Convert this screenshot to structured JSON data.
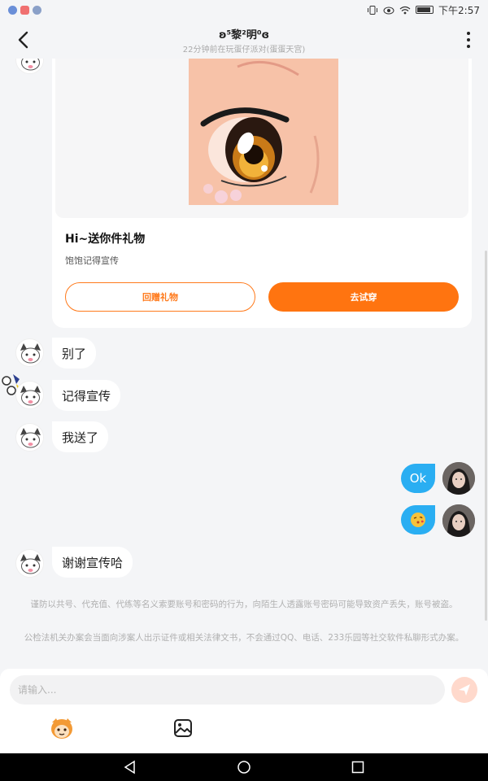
{
  "status_bar": {
    "time": "下午2:57"
  },
  "header": {
    "title": "ʚ⁵黎²明⁰ɞ",
    "subtitle": "22分钟前在玩蛋仔派对(蛋蛋天宫)"
  },
  "gift_card": {
    "title": "Hi~送你件礼物",
    "subtitle": "饱饱记得宣传",
    "return_gift_label": "回赠礼物",
    "try_on_label": "去试穿"
  },
  "messages": [
    {
      "side": "left",
      "text": "别了"
    },
    {
      "side": "left",
      "text": "记得宣传"
    },
    {
      "side": "left",
      "text": "我送了"
    },
    {
      "side": "right",
      "text": "Ok"
    },
    {
      "side": "right",
      "emoji": "kiss-emoji"
    },
    {
      "side": "left",
      "text": "谢谢宣传哈"
    }
  ],
  "notice": {
    "line1": "谨防以共号、代充值、代练等名义索要账号和密码的行为，向陌生人透露账号密码可能导致资产丢失，账号被盗。",
    "line2": "公检法机关办案会当面向涉案人出示证件或相关法律文书，不会通过QQ、电话、233乐园等社交软件私聊形式办案。"
  },
  "input": {
    "placeholder": "请输入..."
  },
  "colors": {
    "accent_orange": "#ff7410",
    "bubble_blue": "#2aaef2",
    "background": "#f4f5f7"
  }
}
